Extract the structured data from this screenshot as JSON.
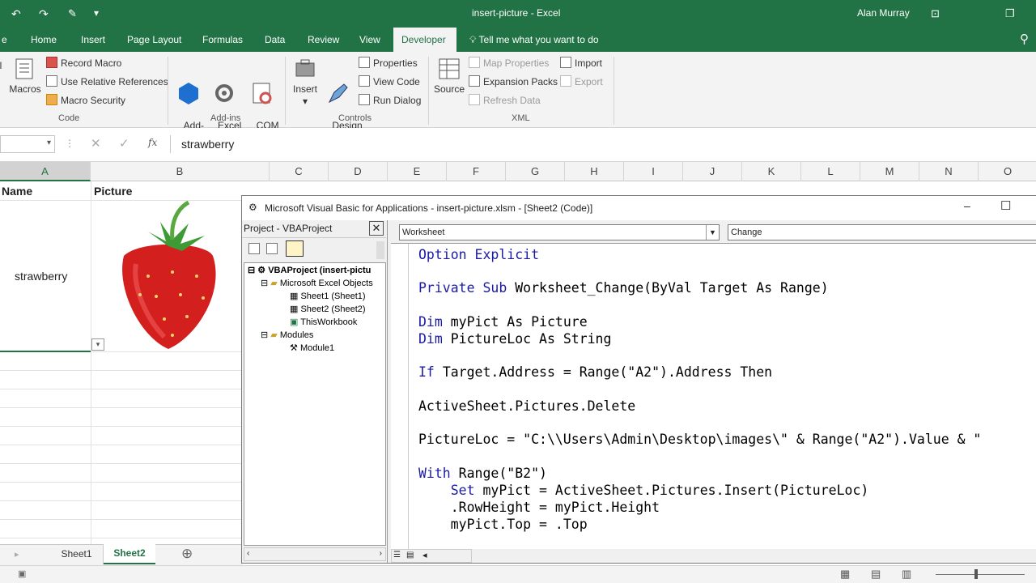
{
  "window": {
    "title": "insert-picture  -  Excel",
    "user": "Alan Murray"
  },
  "tabs": [
    {
      "label": "Home"
    },
    {
      "label": "Insert"
    },
    {
      "label": "Page Layout"
    },
    {
      "label": "Formulas"
    },
    {
      "label": "Data"
    },
    {
      "label": "Review"
    },
    {
      "label": "View"
    },
    {
      "label": "Developer"
    }
  ],
  "tell_me": "Tell me what you want to do",
  "ribbon": {
    "code": {
      "label": "Code",
      "macros": "Macros",
      "record_macro": "Record Macro",
      "relative_refs": "Use Relative References",
      "macro_security": "Macro Security"
    },
    "addins": {
      "label": "Add-ins",
      "addins": "Add-\nins",
      "excel_addins": "Excel\nAdd-ins",
      "com_addins": "COM\nAdd-ins"
    },
    "controls": {
      "label": "Controls",
      "insert": "Insert",
      "design_mode": "Design\nMode",
      "properties": "Properties",
      "view_code": "View Code",
      "run_dialog": "Run Dialog"
    },
    "xml": {
      "label": "XML",
      "source": "Source",
      "map_properties": "Map Properties",
      "expansion_packs": "Expansion Packs",
      "refresh_data": "Refresh Data",
      "import": "Import",
      "export": "Export"
    }
  },
  "formula_bar": {
    "value": "strawberry",
    "fx": "fx"
  },
  "columns": [
    "A",
    "B",
    "C",
    "D",
    "E",
    "F",
    "G",
    "H",
    "I",
    "J",
    "K",
    "L",
    "M",
    "N",
    "O"
  ],
  "sheet": {
    "header_name": "Name",
    "header_picture": "Picture",
    "a2_value": "strawberry"
  },
  "sheet_tabs": [
    "Sheet1",
    "Sheet2"
  ],
  "active_sheet": "Sheet2",
  "vba": {
    "title": "Microsoft Visual Basic for Applications - insert-picture.xlsm - [Sheet2 (Code)]",
    "project_title": "Project - VBAProject",
    "tree": [
      "VBAProject (insert-pictu",
      "Microsoft Excel Objects",
      "Sheet1 (Sheet1)",
      "Sheet2 (Sheet2)",
      "ThisWorkbook",
      "Modules",
      "Module1"
    ],
    "object_combo": "Worksheet",
    "proc_combo": "Change",
    "code_lines": [
      {
        "kw": "Option Explicit",
        "rest": ""
      },
      {
        "kw": "Private Sub ",
        "rest": "Worksheet_Change(ByVal Target As Range)"
      },
      {
        "kw": "Dim ",
        "rest": "myPict As Picture"
      },
      {
        "kw": "Dim ",
        "rest": "PictureLoc As String"
      },
      {
        "kw": "If ",
        "rest": "Target.Address = Range(\"A2\").Address Then"
      },
      {
        "kw": "",
        "rest": "ActiveSheet.Pictures.Delete"
      },
      {
        "kw": "",
        "rest": "PictureLoc = \"C:\\\\Users\\Admin\\Desktop\\images\\\" & Range(\"A2\").Value & \""
      },
      {
        "kw": "With ",
        "rest": "Range(\"B2\")"
      },
      {
        "kw": "    Set ",
        "rest": "myPict = ActiveSheet.Pictures.Insert(PictureLoc)"
      },
      {
        "kw": "    ",
        "rest": ".RowHeight = myPict.Height"
      },
      {
        "kw": "    ",
        "rest": "myPict.Top = .Top"
      }
    ]
  },
  "colors": {
    "excel_green": "#217346",
    "vba_keyword": "#1a1aa6"
  }
}
